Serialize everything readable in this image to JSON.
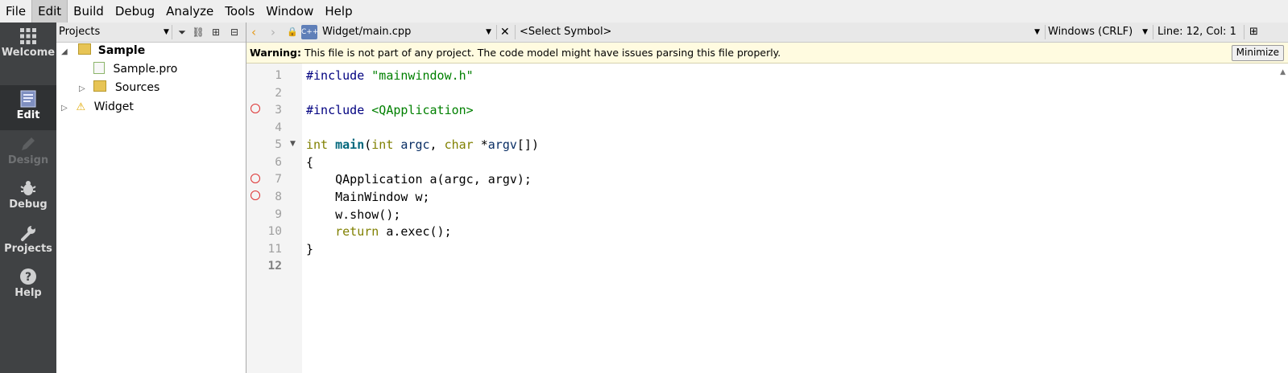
{
  "menu": [
    "File",
    "Edit",
    "Build",
    "Debug",
    "Analyze",
    "Tools",
    "Window",
    "Help"
  ],
  "modes": [
    "Welcome",
    "Edit",
    "Design",
    "Debug",
    "Projects",
    "Help"
  ],
  "projects_panel": {
    "title": "Projects",
    "tree": {
      "root": "Sample",
      "file": "Sample.pro",
      "sources": "Sources",
      "other": "Widget"
    }
  },
  "editor": {
    "file": "Widget/main.cpp",
    "symbol": "<Select Symbol>",
    "line_endings": "Windows (CRLF)",
    "cursor": "Line: 12, Col: 1"
  },
  "warning": {
    "label": "Warning:",
    "message": " This file is not part of any project. The code model might have issues parsing this file properly.",
    "button": "Minimize"
  },
  "code_lines": {
    "n1": "1",
    "n2": "2",
    "n3": "3",
    "n4": "4",
    "n5": "5",
    "n6": "6",
    "n7": "7",
    "n8": "8",
    "n9": "9",
    "n10": "10",
    "n11": "11",
    "n12": "12"
  },
  "code": {
    "l1_directive": "#include",
    "l1_file": "\"mainwindow.h\"",
    "l3_directive": "#include",
    "l3_file": "<QApplication>",
    "l5_type": "int",
    "l5_func": "main",
    "l5_p1": "(",
    "l5_t1": "int",
    "l5_a1": "argc",
    "l5_comma": ", ",
    "l5_t2": "char",
    "l5_star": " *",
    "l5_a2": "argv",
    "l5_end": "[])",
    "l6": "{",
    "l7": "    QApplication a(argc, argv);",
    "l8": "    MainWindow w;",
    "l9": "    w.show();",
    "l10_kw": "return",
    "l10_rest": " a.exec();",
    "l11": "}"
  },
  "colors": {
    "keyword": "#808000",
    "function": "#00677c",
    "preprocessor": "#000080",
    "string": "#008000",
    "breakpoint": "#dd3333"
  }
}
